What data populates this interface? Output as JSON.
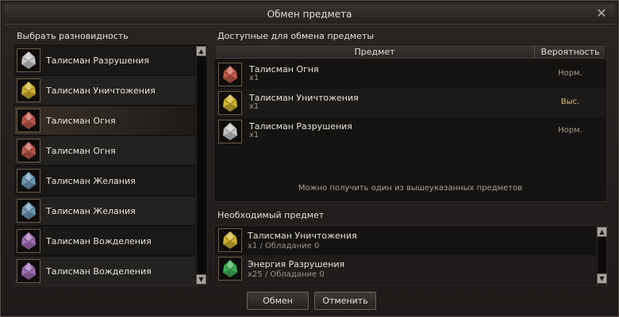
{
  "window": {
    "title": "Обмен предмета"
  },
  "left": {
    "heading": "Выбрать разновидность",
    "items": [
      {
        "label": "Талисман Разрушения",
        "icon": "white-crystal-icon",
        "color": "#dcdcdc"
      },
      {
        "label": "Талисман Уничтожения",
        "icon": "yellow-crystal-icon",
        "color": "#e3c431"
      },
      {
        "label": "Талисман Огня",
        "icon": "red-crystal-icon",
        "color": "#d06050"
      },
      {
        "label": "Талисман Огня",
        "icon": "red-crystal-icon",
        "color": "#d06050"
      },
      {
        "label": "Талисман Желания",
        "icon": "blue-crystal-icon",
        "color": "#78a8c8"
      },
      {
        "label": "Талисман Желания",
        "icon": "blue-crystal-icon",
        "color": "#78a8c8"
      },
      {
        "label": "Талисман Вожделения",
        "icon": "purple-crystal-icon",
        "color": "#b07ac8"
      },
      {
        "label": "Талисман Вожделения",
        "icon": "purple-crystal-icon",
        "color": "#b07ac8"
      }
    ]
  },
  "available": {
    "heading": "Доступные для обмена предметы",
    "col_item": "Предмет",
    "col_prob": "Вероятность",
    "rows": [
      {
        "name": "Талисман Огня",
        "qty": "x1",
        "prob": "Норм.",
        "icon": "red-crystal-icon",
        "color": "#d06050"
      },
      {
        "name": "Талисман Уничтожения",
        "qty": "x1",
        "prob": "Выс.",
        "icon": "yellow-crystal-icon",
        "color": "#e3c431"
      },
      {
        "name": "Талисман Разрушения",
        "qty": "x1",
        "prob": "Норм.",
        "icon": "white-crystal-icon",
        "color": "#dcdcdc"
      }
    ],
    "note": "Можно получить один из вышеуказанных предметов"
  },
  "required": {
    "heading": "Необходимый предмет",
    "rows": [
      {
        "name": "Талисман Уничтожения",
        "qty": "x1 / Обладание 0",
        "icon": "yellow-crystal-icon",
        "color": "#e3c431"
      },
      {
        "name": "Энергия Разрушения",
        "qty": "x25 / Обладание 0",
        "icon": "green-energy-icon",
        "color": "#3fbf5a"
      }
    ]
  },
  "buttons": {
    "exchange": "Обмен",
    "cancel": "Отменить"
  },
  "icons": {
    "close": "close-icon",
    "scroll_up": "scroll-up-icon",
    "scroll_down": "scroll-down-icon"
  }
}
